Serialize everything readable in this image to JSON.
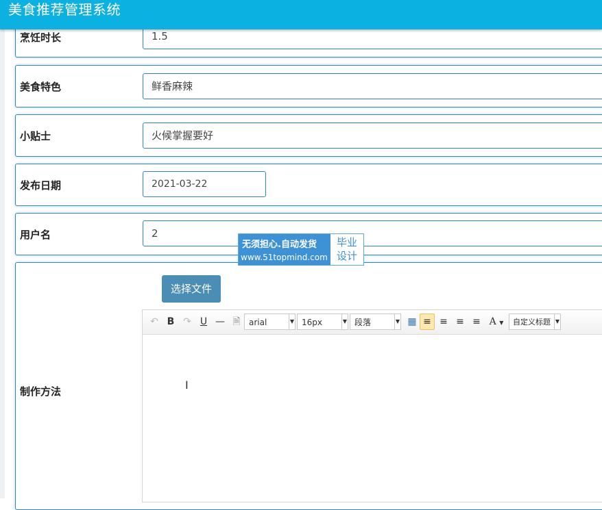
{
  "app": {
    "title": "美食推荐管理系统"
  },
  "form": {
    "rows": [
      {
        "label": "烹饪时长",
        "value": "1.5"
      },
      {
        "label": "美食特色",
        "value": "鲜香麻辣"
      },
      {
        "label": "小贴士",
        "value": "火候掌握要好"
      },
      {
        "label": "发布日期",
        "value": "2021-03-22"
      },
      {
        "label": "用户名",
        "value": "2"
      }
    ],
    "method": {
      "label": "制作方法",
      "upload_label": "选择文件"
    }
  },
  "watermark": {
    "line1": "无须担心.自动发货",
    "line2": "www.51topmind.com",
    "right1": "毕业",
    "right2": "设计"
  },
  "editor": {
    "font_family": "arial",
    "font_size": "16px",
    "paragraph": "段落",
    "custom_title": "自定义标题",
    "bold": "B",
    "underline": "U",
    "font_color": "A"
  },
  "colors": {
    "topbar": "#0bb1e0",
    "row_border": "#2e86c1",
    "upload_button": "#4a8db5"
  }
}
